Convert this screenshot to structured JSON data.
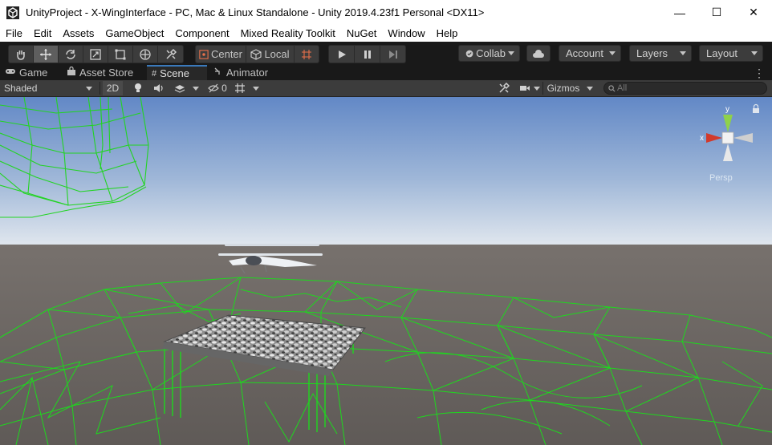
{
  "window": {
    "title": "UnityProject - X-WingInterface - PC, Mac & Linux Standalone - Unity 2019.4.23f1 Personal <DX11>",
    "app_icon": "unity-logo-icon",
    "controls": {
      "minimize": "—",
      "maximize": "☐",
      "close": "✕"
    }
  },
  "menu": [
    "File",
    "Edit",
    "Assets",
    "GameObject",
    "Component",
    "Mixed Reality Toolkit",
    "NuGet",
    "Window",
    "Help"
  ],
  "toolbar": {
    "tools": [
      "hand-icon",
      "move-icon",
      "rotate-icon",
      "scale-icon",
      "rect-tool-icon",
      "transform-icon",
      "custom-tool-icon"
    ],
    "pivot": "Center",
    "space": "Local",
    "playback": [
      "play-icon",
      "pause-icon",
      "step-icon"
    ],
    "collab": "Collab",
    "account": "Account",
    "layers": "Layers",
    "layout": "Layout"
  },
  "tabs": [
    {
      "label": "Game",
      "icon": "gamepad-icon"
    },
    {
      "label": "Asset Store",
      "icon": "store-bag-icon"
    },
    {
      "label": "Scene",
      "icon": "grid-hash-icon",
      "active": true
    },
    {
      "label": "Animator",
      "icon": "animator-icon"
    }
  ],
  "scene_bar": {
    "draw_mode": "Shaded",
    "two_d": "2D",
    "hidden_count": "0",
    "gizmos": "Gizmos",
    "search_placeholder": "All"
  },
  "gizmo": {
    "x_label": "x",
    "y_label": "y",
    "persp_label": "Persp"
  },
  "colors": {
    "titlebar": "#ffffff",
    "editor_dark": "#191919",
    "panel": "#3c3c3c",
    "tab_accent": "#3a79bb",
    "wireframe": "#1bd01b",
    "sky_top": "#5d87c9",
    "ground": "#6a6562"
  }
}
